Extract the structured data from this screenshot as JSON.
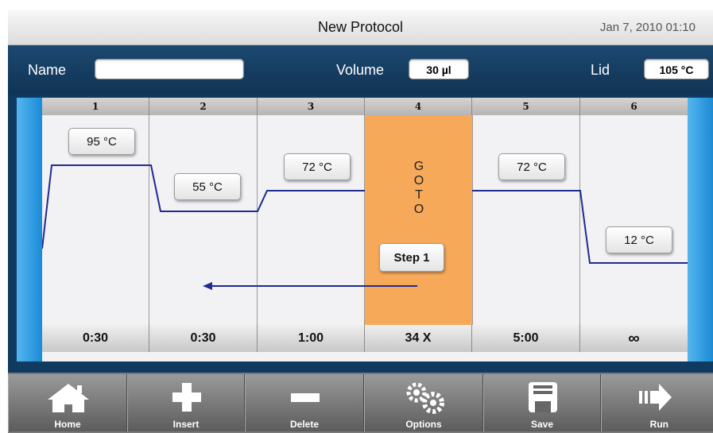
{
  "header": {
    "title": "New Protocol",
    "datetime": "Jan 7, 2010 01:10"
  },
  "info": {
    "name_label": "Name",
    "name_value": "",
    "volume_label": "Volume",
    "volume_value": "30 µl",
    "lid_label": "Lid",
    "lid_value": "105 °C"
  },
  "steps": [
    {
      "number": "1",
      "temp": "95 °C",
      "time": "0:30"
    },
    {
      "number": "2",
      "temp": "55 °C",
      "time": "0:30"
    },
    {
      "number": "3",
      "temp": "72 °C",
      "time": "1:00"
    },
    {
      "number": "4",
      "goto_letters": [
        "G",
        "O",
        "T",
        "O"
      ],
      "goto_target": "Step 1",
      "time": "34 X"
    },
    {
      "number": "5",
      "temp": "72 °C",
      "time": "5:00"
    },
    {
      "number": "6",
      "temp": "12 °C",
      "time": "∞"
    }
  ],
  "toolbar": [
    {
      "label": "Home",
      "icon": "home-icon"
    },
    {
      "label": "Insert",
      "icon": "plus-icon"
    },
    {
      "label": "Delete",
      "icon": "minus-icon"
    },
    {
      "label": "Options",
      "icon": "gears-icon"
    },
    {
      "label": "Save",
      "icon": "floppy-disk-icon"
    },
    {
      "label": "Run",
      "icon": "run-arrow-icon"
    }
  ],
  "colors": {
    "goto_highlight": "#f7a95a",
    "profile_line": "#1f2b8f",
    "accent_blue": "#1b8ad6"
  }
}
